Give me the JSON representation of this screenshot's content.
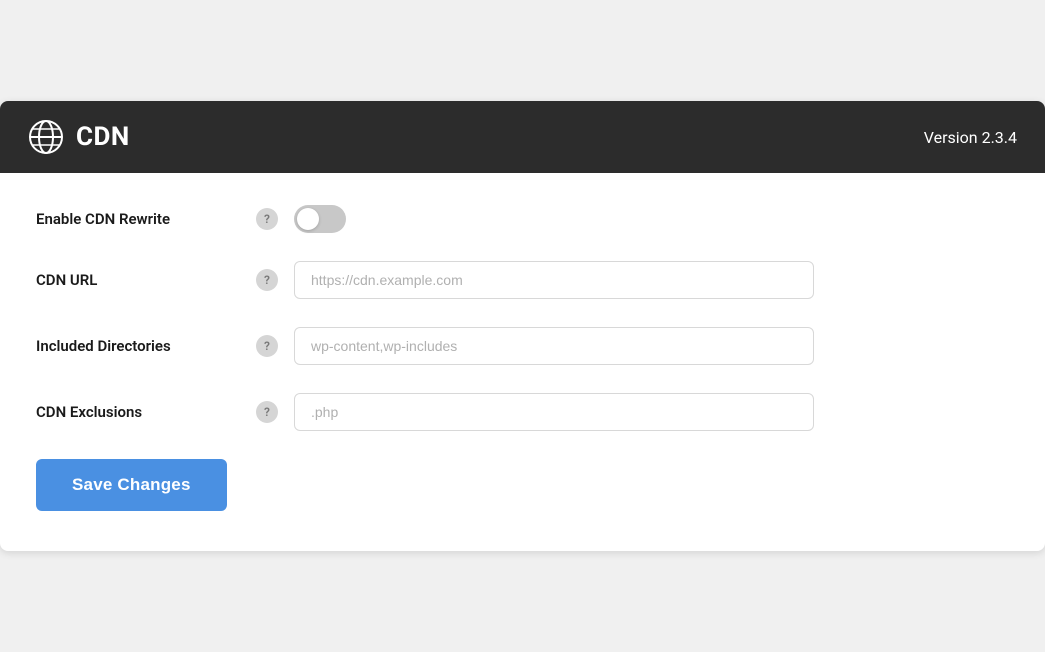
{
  "header": {
    "title": "CDN",
    "version_label": "Version 2.3.4"
  },
  "form": {
    "rows": [
      {
        "id": "enable-cdn-rewrite",
        "label": "Enable CDN Rewrite",
        "type": "toggle",
        "checked": false,
        "help": "?"
      },
      {
        "id": "cdn-url",
        "label": "CDN URL",
        "type": "text",
        "placeholder": "https://cdn.example.com",
        "value": "",
        "help": "?"
      },
      {
        "id": "included-directories",
        "label": "Included Directories",
        "type": "text",
        "placeholder": "wp-content,wp-includes",
        "value": "",
        "help": "?"
      },
      {
        "id": "cdn-exclusions",
        "label": "CDN Exclusions",
        "type": "text",
        "placeholder": ".php",
        "value": "",
        "help": "?"
      }
    ]
  },
  "buttons": {
    "save_label": "Save Changes"
  }
}
